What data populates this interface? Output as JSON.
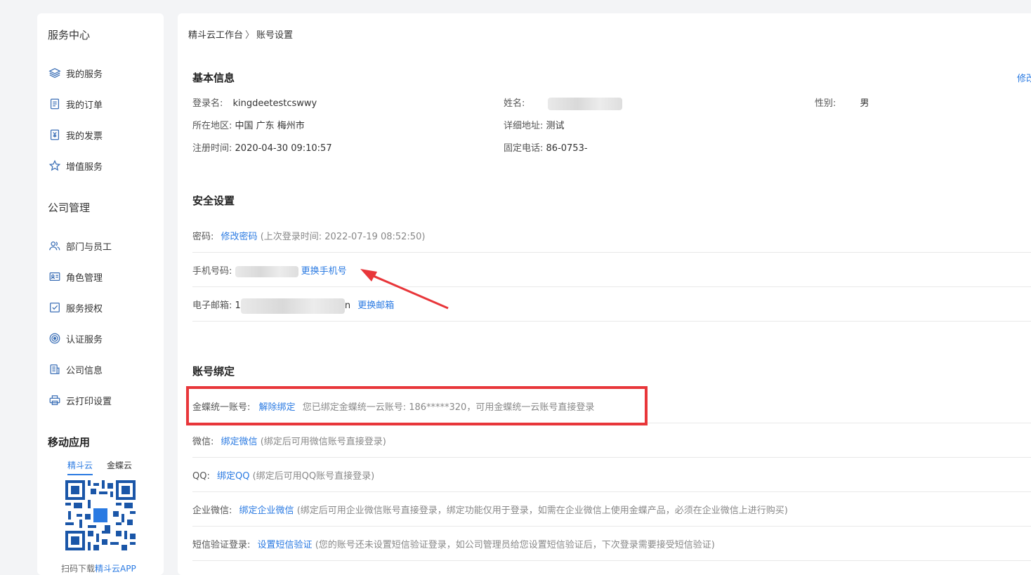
{
  "sidebar": {
    "service_center": "服务中心",
    "service_items": [
      {
        "label": "我的服务",
        "icon": "layers-icon"
      },
      {
        "label": "我的订单",
        "icon": "document-icon"
      },
      {
        "label": "我的发票",
        "icon": "invoice-icon"
      },
      {
        "label": "增值服务",
        "icon": "star-icon"
      }
    ],
    "company_mgmt": "公司管理",
    "company_items": [
      {
        "label": "部门与员工",
        "icon": "users-icon"
      },
      {
        "label": "角色管理",
        "icon": "id-card-icon"
      },
      {
        "label": "服务授权",
        "icon": "checkbox-icon"
      },
      {
        "label": "认证服务",
        "icon": "target-icon"
      },
      {
        "label": "公司信息",
        "icon": "building-doc-icon"
      },
      {
        "label": "云打印设置",
        "icon": "printer-icon"
      }
    ],
    "mobile_apps": "移动应用",
    "app_tabs": [
      "精斗云",
      "金蝶云"
    ],
    "qr_caption_prefix": "扫码下载",
    "qr_caption_link": "精斗云APP"
  },
  "breadcrumb": {
    "root": "精斗云工作台",
    "separator": "〉",
    "current": "账号设置"
  },
  "basic_info": {
    "title": "基本信息",
    "edit_label": "修改",
    "login_name_label": "登录名:",
    "login_name": "kingdeetestcswwy",
    "name_label": "姓名:",
    "gender_label": "性别:",
    "gender": "男",
    "region_label": "所在地区:",
    "region": "中国 广东 梅州市",
    "address_label": "详细地址:",
    "address": "测试",
    "reg_time_label": "注册时间:",
    "reg_time": "2020-04-30 09:10:57",
    "phone_label": "固定电话:",
    "phone": "86-0753-"
  },
  "security": {
    "title": "安全设置",
    "password_label": "密码:",
    "password_link": "修改密码",
    "password_desc": "(上次登录时间: 2022-07-19 08:52:50)",
    "mobile_label": "手机号码:",
    "mobile_link": "更换手机号",
    "email_label": "电子邮箱:",
    "email_prefix": "1",
    "email_suffix": "n",
    "email_link": "更换邮箱"
  },
  "binding": {
    "title": "账号绑定",
    "rows": [
      {
        "label": "金蝶统一账号:",
        "link": "解除绑定",
        "desc": "您已绑定金蝶统一云账号: 186*****320，可用金蝶统一云账号直接登录"
      },
      {
        "label": "微信:",
        "link": "绑定微信",
        "desc": "(绑定后可用微信账号直接登录)"
      },
      {
        "label": "QQ:",
        "link": "绑定QQ",
        "desc": "(绑定后可用QQ账号直接登录)"
      },
      {
        "label": "企业微信:",
        "link": "绑定企业微信",
        "desc": "(绑定后可用企业微信账号直接登录，绑定功能仅用于登录，如需在企业微信上使用金蝶产品，必须在企业微信上进行购买)"
      },
      {
        "label": "短信验证登录:",
        "link": "设置短信验证",
        "desc": "(您的账号还未设置短信验证登录，如公司管理员给您设置短信验证后，下次登录需要接受短信验证)"
      }
    ]
  },
  "colors": {
    "accent": "#2a7ae2",
    "highlight": "#e8363a",
    "background": "#f3f4f6"
  }
}
